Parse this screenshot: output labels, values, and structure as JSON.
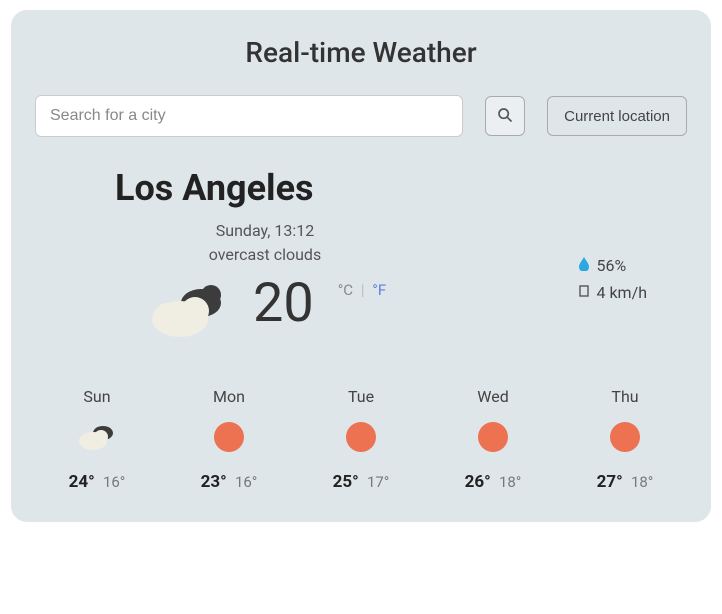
{
  "header": {
    "title": "Real-time Weather"
  },
  "search": {
    "placeholder": "Search for a city",
    "value": "",
    "loc_label": "Current location"
  },
  "current": {
    "city": "Los Angeles",
    "datetime": "Sunday, 13:12",
    "condition": "overcast clouds",
    "temp": "20",
    "unit_c": "°C",
    "unit_sep": "|",
    "unit_f": "°F",
    "humidity": "56%",
    "wind": "4 km/h"
  },
  "forecast": [
    {
      "day": "Sun",
      "icon": "cloud",
      "hi": "24°",
      "lo": "16°"
    },
    {
      "day": "Mon",
      "icon": "sun",
      "hi": "23°",
      "lo": "16°"
    },
    {
      "day": "Tue",
      "icon": "sun",
      "hi": "25°",
      "lo": "17°"
    },
    {
      "day": "Wed",
      "icon": "sun",
      "hi": "26°",
      "lo": "18°"
    },
    {
      "day": "Thu",
      "icon": "sun",
      "hi": "27°",
      "lo": "18°"
    }
  ]
}
